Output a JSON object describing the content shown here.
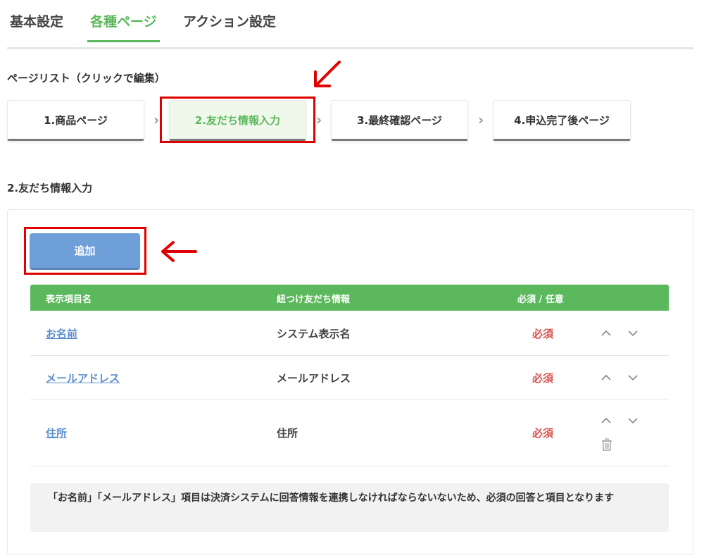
{
  "tabs": [
    {
      "label": "基本設定",
      "active": false
    },
    {
      "label": "各種ページ",
      "active": true
    },
    {
      "label": "アクション設定",
      "active": false
    }
  ],
  "page_list": {
    "title": "ページリスト（クリックで編集）",
    "steps": [
      {
        "label": "1.商品ページ",
        "active": false
      },
      {
        "label": "2.友だち情報入力",
        "active": true
      },
      {
        "label": "3.最終確認ページ",
        "active": false
      },
      {
        "label": "4.申込完了後ページ",
        "active": false
      }
    ],
    "separator": "›"
  },
  "detail": {
    "title": "2.友だち情報入力",
    "add_label": "追加",
    "columns": [
      "表示項目名",
      "紐つけ友だち情報",
      "必須 / 任意"
    ],
    "rows": [
      {
        "name": "お名前",
        "linked": "システム表示名",
        "required": "必須"
      },
      {
        "name": "メールアドレス",
        "linked": "メールアドレス",
        "required": "必須"
      },
      {
        "name": "住所",
        "linked": "住所",
        "required": "必須"
      }
    ],
    "note": "「お名前」「メールアドレス」項目は決済システムに回答情報を連携しなければならないないため、必須の回答と項目となります"
  },
  "colors": {
    "accent": "#5cb85c",
    "button": "#6f9fd8",
    "required": "#d9534f",
    "annotation": "#e00000"
  },
  "icons": [
    "chevron-up-icon",
    "chevron-down-icon",
    "trash-icon",
    "chevron-right-icon"
  ]
}
